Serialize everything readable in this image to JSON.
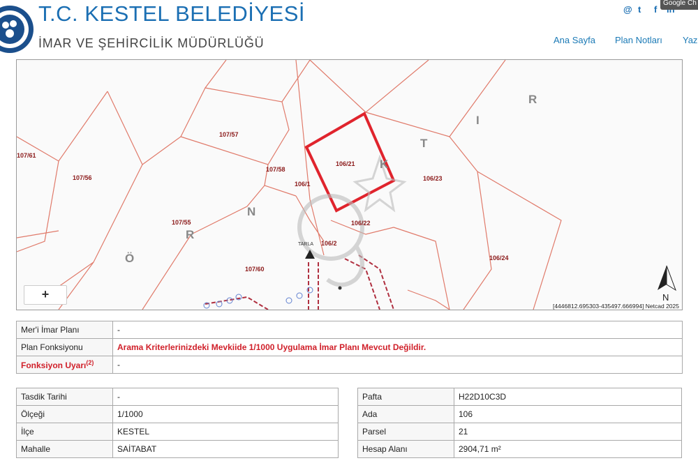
{
  "header": {
    "title": "T.C. KESTEL BELEDİYESİ",
    "subtitle": "İMAR VE ŞEHİRCİLİK MÜDÜRLÜĞÜ",
    "google_badge": "Google Ch",
    "social": {
      "at": "@",
      "twitter": "t",
      "facebook": "f",
      "linkedin": "in"
    },
    "nav": [
      "Ana Sayfa",
      "Plan Notları",
      "Yazı"
    ]
  },
  "map": {
    "zoom_label": "+",
    "north": "N",
    "coords": "[4446812.695303-435497.666994] Netcad 2025",
    "parcels": [
      "107/57",
      "107/56",
      "107/58",
      "107/55",
      "107/60",
      "107/61",
      "106/21",
      "106/23",
      "106/22",
      "106/24",
      "106/1",
      "106/2"
    ],
    "street_letters": [
      "R",
      "I",
      "T",
      "K",
      "N",
      "R",
      "Ö"
    ],
    "label_tarla": "TARLA",
    "colors": {
      "parcel_line": "#e07a6a",
      "selected": "#e0242d",
      "label": "#8b1a1a"
    }
  },
  "info_top": [
    {
      "key": "Mer'i İmar Planı",
      "value": "-",
      "key_red": false,
      "value_red": false
    },
    {
      "key": "Plan Fonksiyonu",
      "value": "Arama Kriterlerinizdeki Mevkiide 1/1000 Uygulama İmar Planı Mevcut Değildir.",
      "key_red": false,
      "value_red": true
    },
    {
      "key": "Fonksiyon Uyarı",
      "key_sup": "(2)",
      "value": "-",
      "key_red": true,
      "value_red": false
    }
  ],
  "info_left": [
    {
      "key": "Tasdik Tarihi",
      "value": "-"
    },
    {
      "key": "Ölçeği",
      "value": "1/1000"
    },
    {
      "key": "İlçe",
      "value": "KESTEL"
    },
    {
      "key": "Mahalle",
      "value": "SAİTABAT"
    }
  ],
  "info_right": [
    {
      "key": "Pafta",
      "value": "H22D10C3D"
    },
    {
      "key": "Ada",
      "value": "106"
    },
    {
      "key": "Parsel",
      "value": "21"
    },
    {
      "key": "Hesap Alanı",
      "value": "2904,71 m²"
    }
  ]
}
